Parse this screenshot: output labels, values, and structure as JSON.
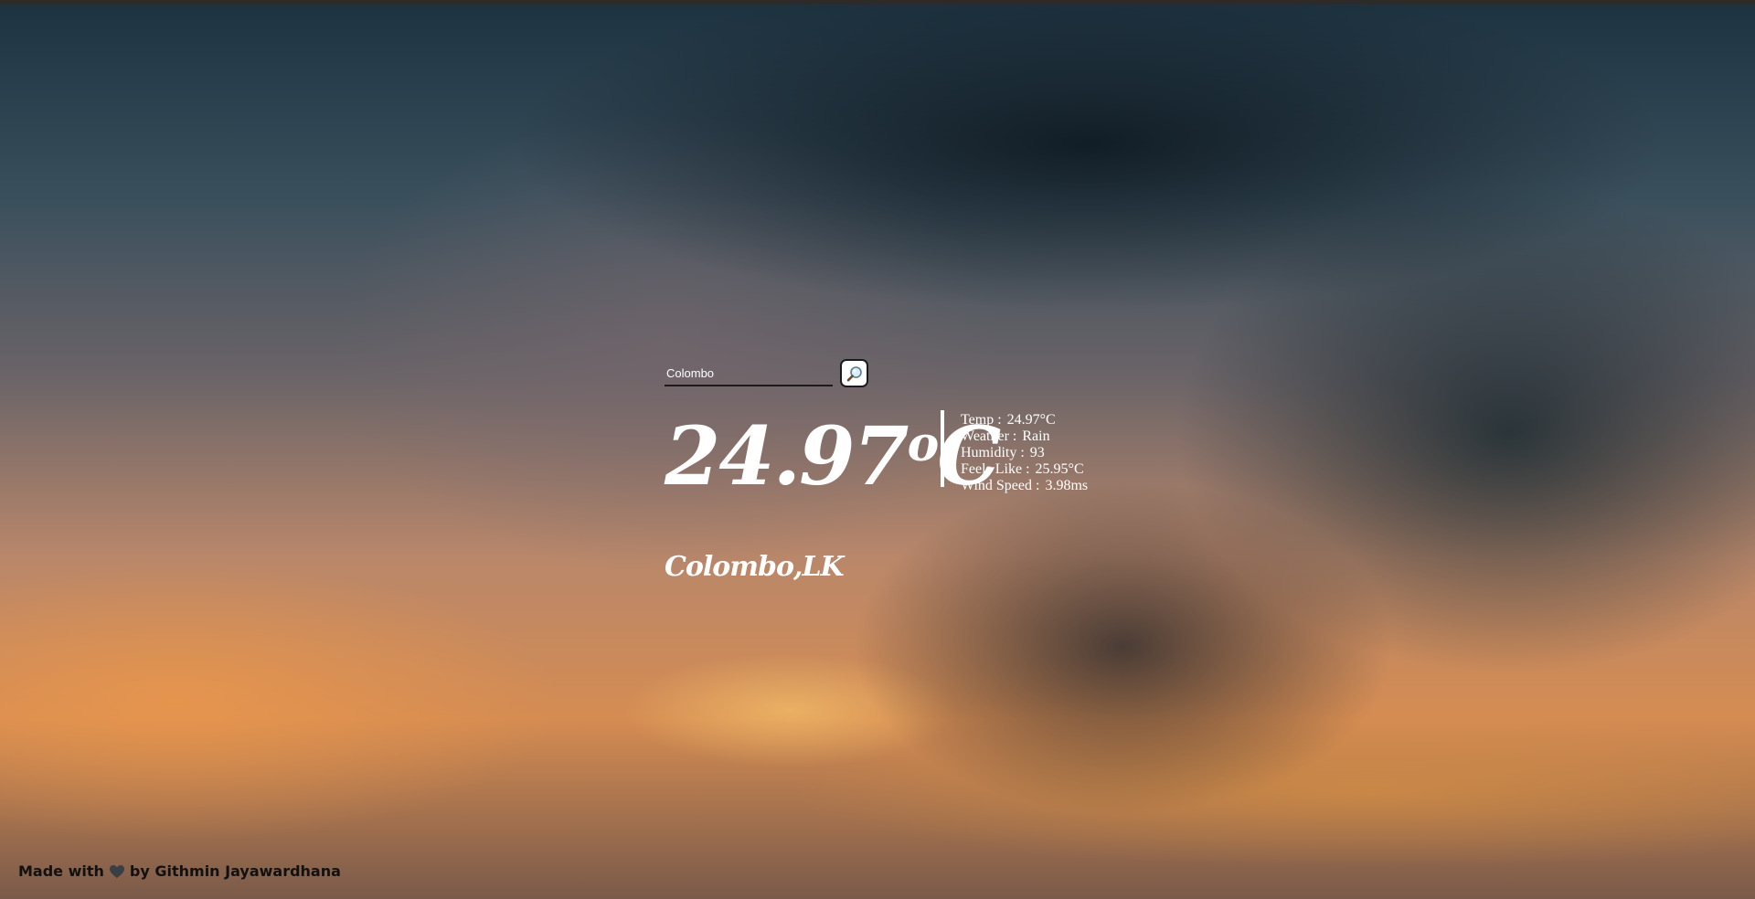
{
  "search": {
    "value": "Colombo",
    "placeholder": "",
    "button_icon": "search-icon"
  },
  "weather": {
    "temperature": "24.97",
    "temperature_unit": "C",
    "details": [
      {
        "label": "Temp :",
        "value": "24.97°C"
      },
      {
        "label": "Weather :",
        "value": "Rain"
      },
      {
        "label": "Humidity :",
        "value": "93"
      },
      {
        "label": "Feels Like :",
        "value": "25.95°C"
      },
      {
        "label": "Wind Speed :",
        "value": "3.98ms"
      }
    ],
    "location": "Colombo,LK"
  },
  "footer": {
    "prefix": "Made with",
    "heart_icon": "heart-icon",
    "suffix": "by Githmin Jayawardhana"
  },
  "colors": {
    "text": "#ffffff",
    "footer_text": "#111111",
    "heart": "#3a3f44"
  }
}
